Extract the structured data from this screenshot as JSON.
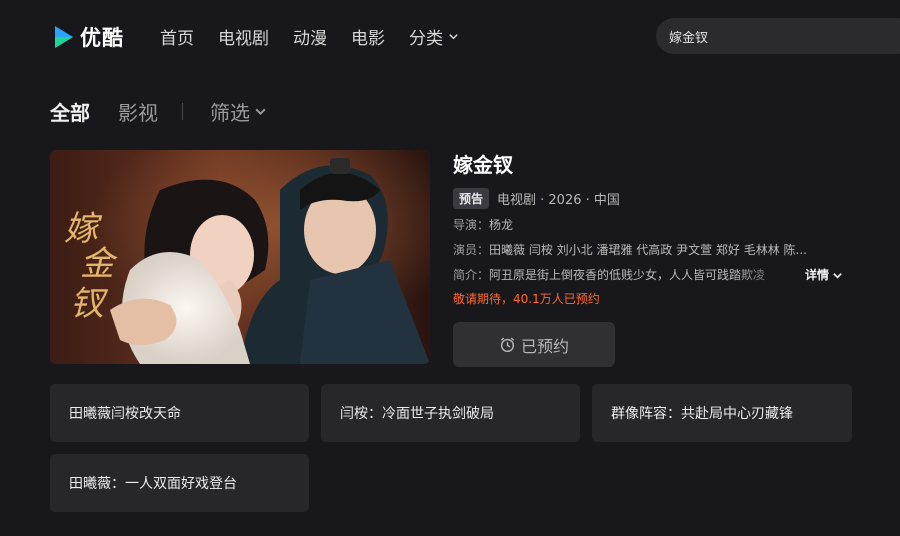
{
  "brand": {
    "name": "优酷",
    "accent_blue": "#27a4ff",
    "accent_green": "#23d396"
  },
  "nav": {
    "items": [
      "首页",
      "电视剧",
      "动漫",
      "电影",
      "分类"
    ]
  },
  "search": {
    "value": "嫁金钗"
  },
  "tabs": {
    "all": "全部",
    "video": "影视",
    "filter": "筛选"
  },
  "show": {
    "title": "嫁金钗",
    "badge": "预告",
    "meta": "电视剧 · 2026 · 中国",
    "director_label": "导演：",
    "director": "杨龙",
    "cast_label": "演员：",
    "cast": "田曦薇 闫桉 刘小北 潘珺雅 代高政 尹文萱 郑好 毛林林 陈...",
    "synopsis_label": "简介：",
    "synopsis": "阿丑原是街上倒夜香的低贱少女，人人皆可践踏欺凌",
    "detail_label": "详情",
    "reserve_count": "敬请期待，40.1万人已预约",
    "reserve_button": "已预约",
    "highlight_color": "#ff6a2c"
  },
  "related": [
    "田曦薇闫桉改天命",
    "闫桉：冷面世子执剑破局",
    "群像阵容：共赴局中心刃藏锋",
    "田曦薇：一人双面好戏登台"
  ]
}
